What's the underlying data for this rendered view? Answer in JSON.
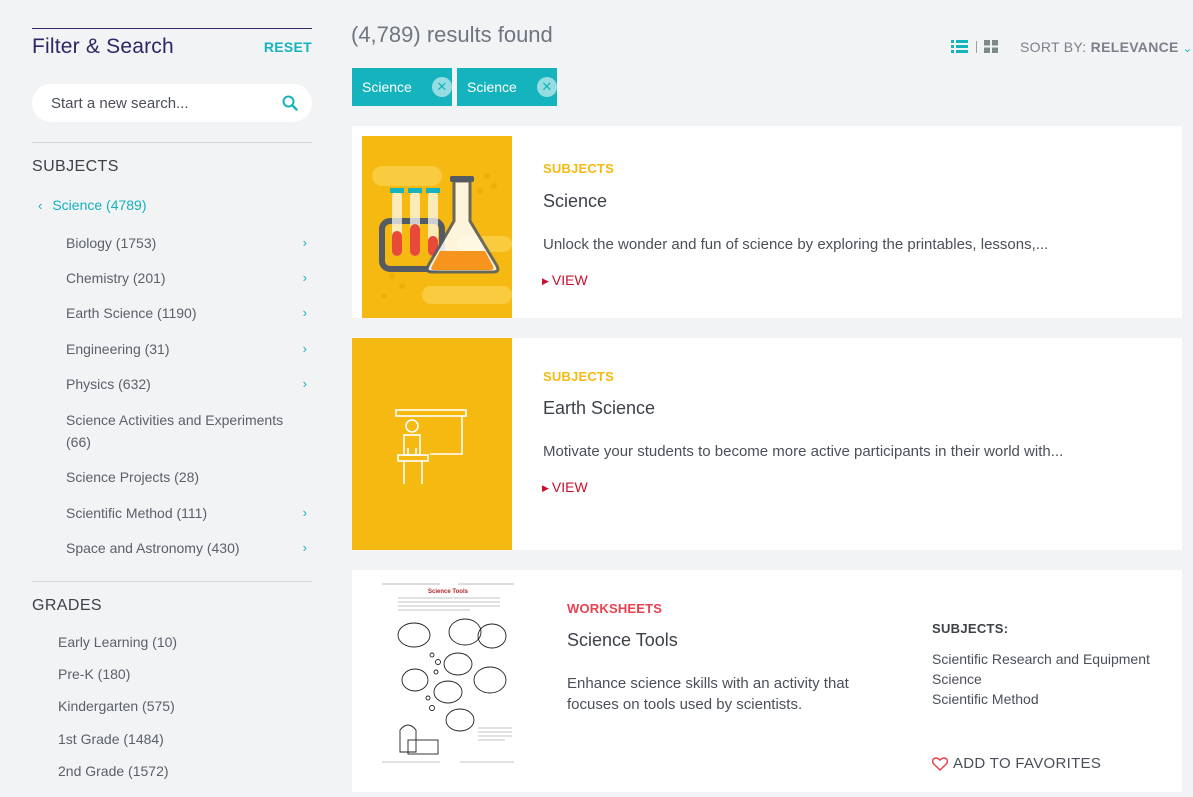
{
  "sidebar": {
    "title": "Filter & Search",
    "reset_label": "RESET",
    "search_placeholder": "Start a new search...",
    "subjects_heading": "SUBJECTS",
    "active_subject": "Science (4789)",
    "subjects": [
      {
        "label": "Biology (1753)",
        "has_children": true
      },
      {
        "label": "Chemistry (201)",
        "has_children": true
      },
      {
        "label": "Earth Science (1190)",
        "has_children": true
      },
      {
        "label": "Engineering (31)",
        "has_children": true
      },
      {
        "label": "Physics (632)",
        "has_children": true
      },
      {
        "label": "Science Activities and Experiments (66)",
        "has_children": false
      },
      {
        "label": "Science Projects (28)",
        "has_children": false
      },
      {
        "label": "Scientific Method (111)",
        "has_children": true
      },
      {
        "label": "Space and Astronomy (430)",
        "has_children": true
      }
    ],
    "grades_heading": "GRADES",
    "grades": [
      "Early Learning (10)",
      "Pre-K (180)",
      "Kindergarten (575)",
      "1st Grade (1484)",
      "2nd Grade (1572)"
    ]
  },
  "main": {
    "results_count": "(4,789) results found",
    "sort_prefix": "SORT BY:",
    "sort_value": "RELEVANCE",
    "chips": [
      "Science",
      "Science"
    ],
    "cards": [
      {
        "eyebrow": "SUBJECTS",
        "title": "Science",
        "description": "Unlock the wonder and fun of science by exploring the printables, lessons,...",
        "view_label": "VIEW"
      },
      {
        "eyebrow": "SUBJECTS",
        "title": "Earth Science",
        "description": "Motivate your students to become more active participants in their world with...",
        "view_label": "VIEW"
      },
      {
        "eyebrow": "WORKSHEETS",
        "title": "Science Tools",
        "description": "Enhance science skills with an activity that focuses on tools used by scientists.",
        "meta_heading": "SUBJECTS:",
        "meta_subjects": [
          "Scientific Research and Equipment",
          "Science",
          "Scientific Method"
        ],
        "favorite_label": "ADD TO FAVORITES",
        "worksheet_title": "Science Tools"
      }
    ]
  },
  "colors": {
    "accent_teal": "#14b3bd",
    "eyebrow_yellow": "#f5b912",
    "eyebrow_red": "#e8424f",
    "view_red": "#c8102e",
    "thumb_yellow": "#f5b912",
    "title_purple": "#2f2566"
  },
  "icons": {
    "search": "search-icon",
    "list_view": "list-view-icon",
    "grid_view": "grid-view-icon",
    "remove": "close-icon",
    "favorite": "heart-icon"
  }
}
